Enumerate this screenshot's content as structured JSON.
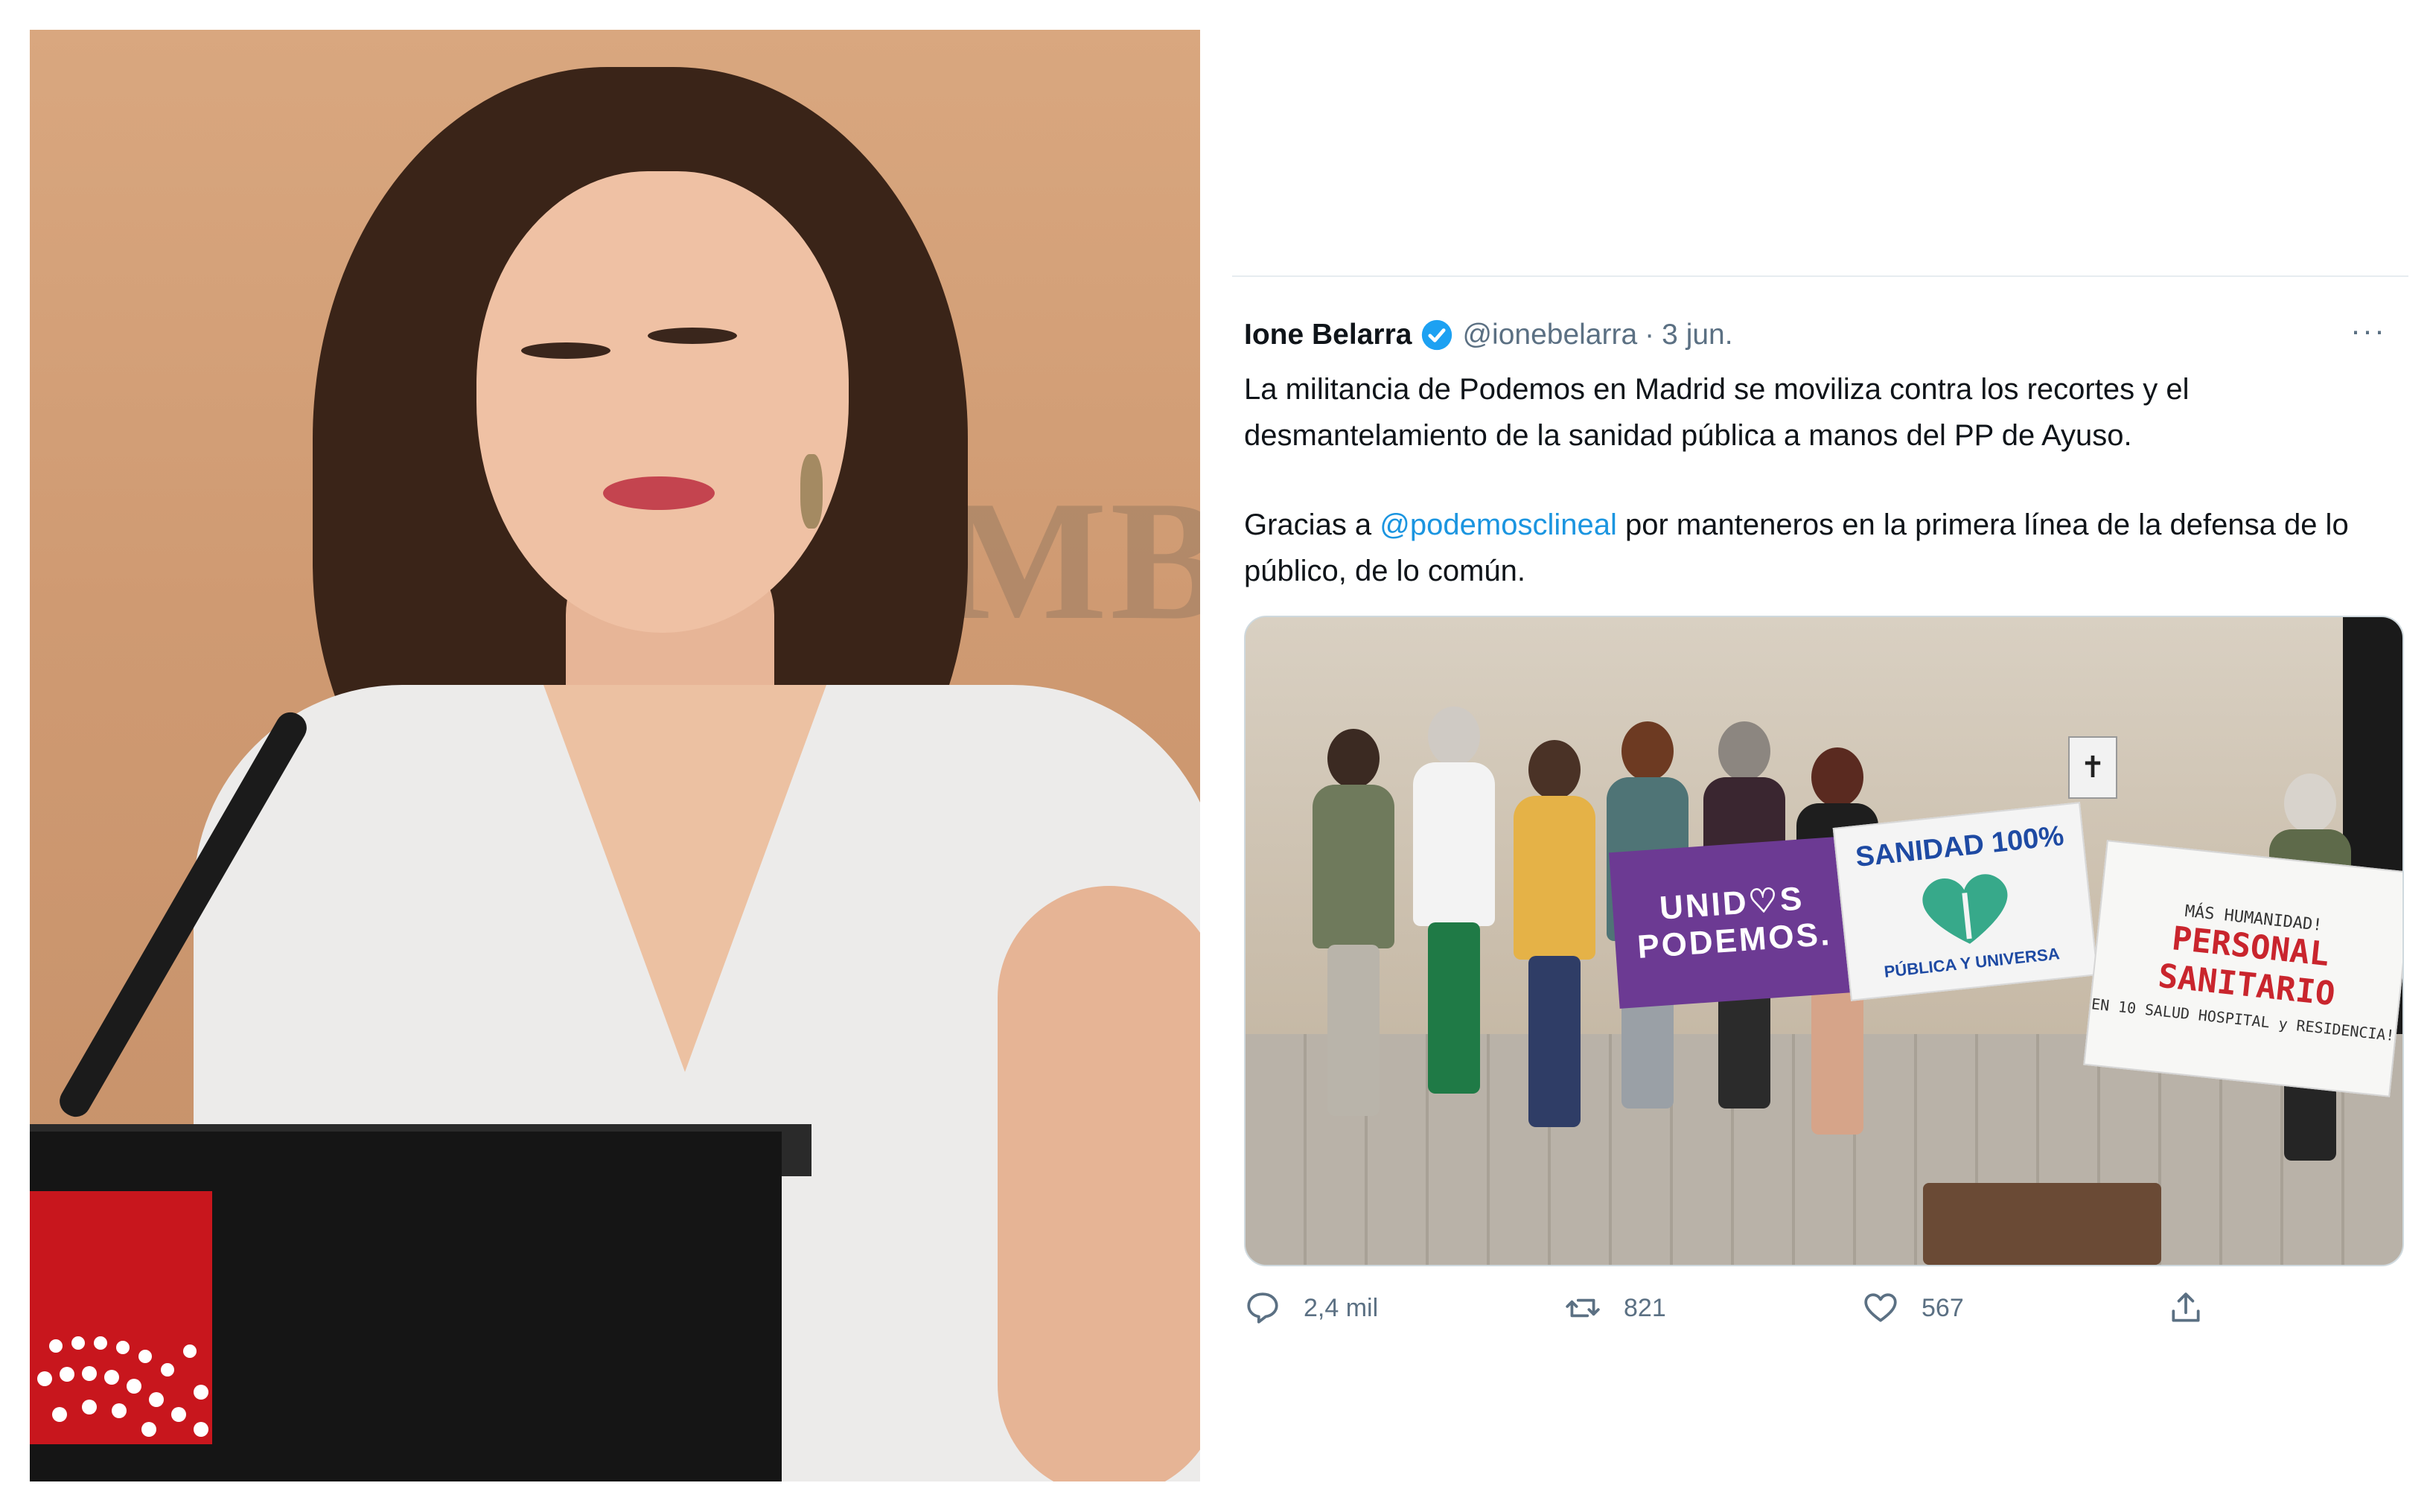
{
  "tweet": {
    "author_name": "Ione Belarra",
    "handle": "@ionebelarra",
    "separator": "·",
    "date": "3 jun.",
    "more_label": "···",
    "text_line1": "La militancia de Podemos en Madrid se moviliza contra los recortes y el desmantelamiento de la sanidad pública a manos del PP de Ayuso.",
    "text_line2_prefix": "Gracias a ",
    "mention": "@podemosclineal",
    "text_line2_suffix": " por manteneros en la primera línea de la defensa de lo público, de lo común.",
    "media": {
      "banner_unidos_line1": "UNID♡S",
      "banner_unidos_line2": "PODEMOS.",
      "banner_sanidad_title": "SANIDAD 100%",
      "banner_sanidad_subtitle": "PÚBLICA Y UNIVERSA",
      "banner_personal_top": "MÁS HUMANIDAD!",
      "banner_personal_line1": "PERSONAL",
      "banner_personal_line2": "SANITARIO",
      "banner_personal_bottom": "EN 10 SALUD HOSPITAL y RESIDENCIA!",
      "small_sign": "✝"
    },
    "actions": {
      "replies": "2,4 mil",
      "retweets": "821",
      "likes": "567"
    }
  },
  "photo_left": {
    "wall_letters": "MBL"
  },
  "colors": {
    "mention": "#1b95e0",
    "secondary_text": "#5b7083",
    "verified": "#1da1f2"
  }
}
